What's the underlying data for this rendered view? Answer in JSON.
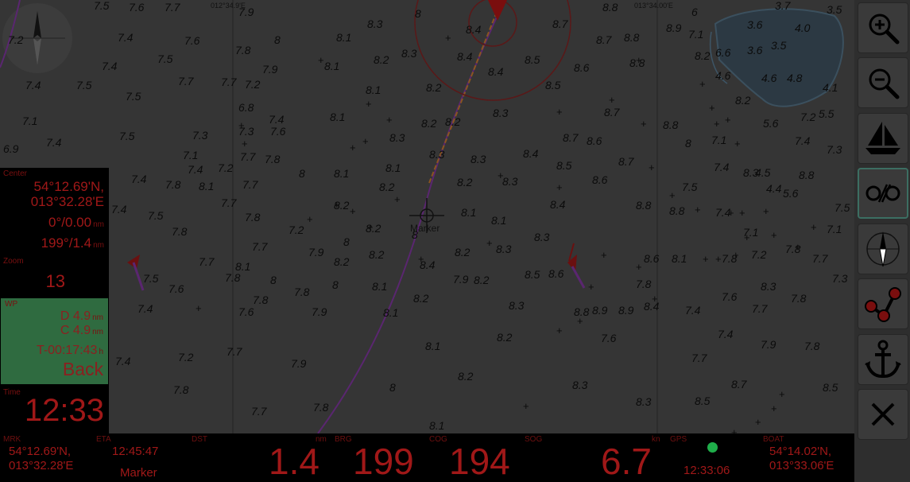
{
  "map": {
    "grid_labels": [
      "012°34.9'E",
      "013°34.00'E"
    ],
    "marker_label": "Marker"
  },
  "left_panel": {
    "center_label": "Center",
    "center_lat": "54°12.69'N,",
    "center_lon": "013°32.28'E",
    "dist_line": {
      "value": "0°/0.00",
      "unit": "nm"
    },
    "brg_line": {
      "value": "199°/1.4",
      "unit": "nm"
    },
    "zoom_label": "Zoom",
    "zoom_value": "13",
    "wpt_label": "WP",
    "wpt_d": {
      "prefix": "D",
      "value": "4.9",
      "unit": "nm"
    },
    "wpt_c": {
      "prefix": "C",
      "value": "4.9",
      "unit": "nm"
    },
    "wpt_t": {
      "value": "T-00:17:43",
      "unit": "h"
    },
    "back_label": "Back",
    "time_label": "Time",
    "time_value": "12:33"
  },
  "toolbar": {
    "buttons": [
      "zoom-in",
      "zoom-out",
      "boat",
      "lock-unlock",
      "compass",
      "route",
      "anchor",
      "close"
    ]
  },
  "bottom_bar": {
    "mrk_label": "MRK",
    "mrk_lat": "54°12.69'N,",
    "mrk_lon": "013°32.28'E",
    "eta_label": "ETA",
    "eta_value": "12:45:47",
    "eta_name": "Marker",
    "dst_label": "DST",
    "dst_unit": "nm",
    "dst_value": "1.4",
    "brg_label": "BRG",
    "brg_value": "199",
    "cog_label": "COG",
    "cog_value": "194",
    "sog_label": "SOG",
    "sog_unit": "kn",
    "sog_value": "6.7",
    "gps_label": "GPS",
    "gps_time": "12:33:06",
    "gps_status_color": "#1fae4a",
    "boat_label": "BOAT",
    "boat_lat": "54°14.02'N,",
    "boat_lon": "013°33.06'E"
  },
  "colors": {
    "night_red": "#a01818",
    "wpt_bg": "#2f6b40",
    "active_border": "#3c6e62"
  }
}
